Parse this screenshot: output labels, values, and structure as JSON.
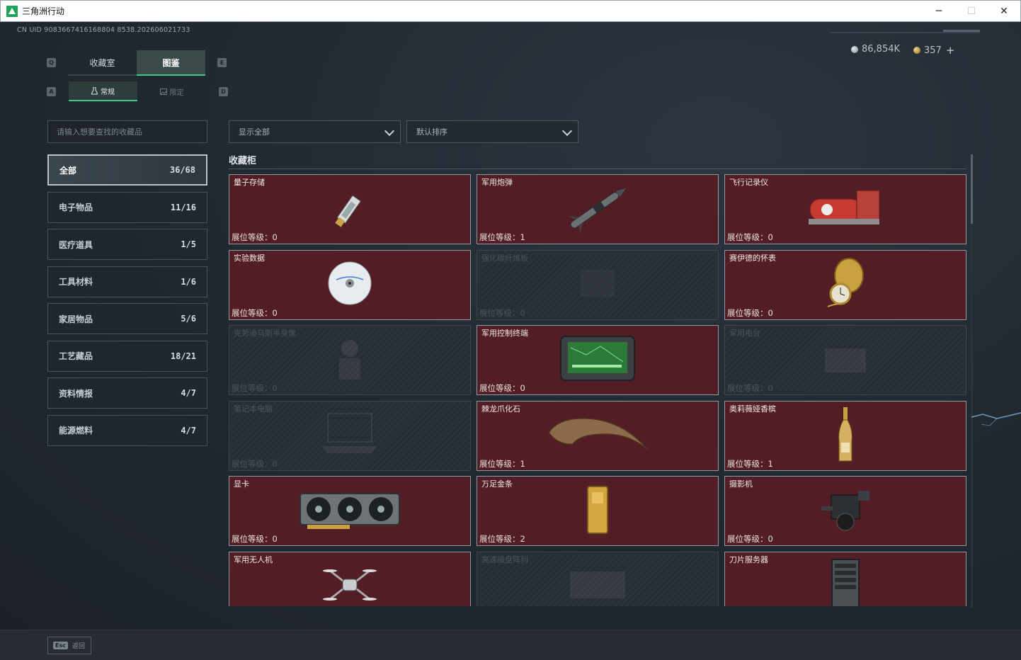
{
  "window": {
    "title": "三角洲行动",
    "minimize": "─",
    "maximize": "☐",
    "close": "✕"
  },
  "uid": "CN UID 9083667416168804 8538.202606021733",
  "currency": {
    "silver": "86,854K",
    "gold": "357",
    "plus": "+"
  },
  "keys": {
    "prev_tab": "Q",
    "next_tab": "E",
    "prev_sub": "A",
    "next_sub": "D"
  },
  "tabs": [
    {
      "label": "收藏室"
    },
    {
      "label": "图鉴"
    }
  ],
  "subtabs": [
    {
      "label": "常规"
    },
    {
      "label": "限定"
    }
  ],
  "search": {
    "placeholder": "请输入想要查找的收藏品"
  },
  "filters": {
    "show": "显示全部",
    "sort": "默认排序"
  },
  "categories": [
    {
      "label": "全部",
      "count": "36/68"
    },
    {
      "label": "电子物品",
      "count": "11/16"
    },
    {
      "label": "医疗道具",
      "count": "1/5"
    },
    {
      "label": "工具材料",
      "count": "1/6"
    },
    {
      "label": "家居物品",
      "count": "5/6"
    },
    {
      "label": "工艺藏品",
      "count": "18/21"
    },
    {
      "label": "资料情报",
      "count": "4/7"
    },
    {
      "label": "能源燃料",
      "count": "4/7"
    }
  ],
  "section_title": "收藏柜",
  "items": [
    {
      "name": "量子存储",
      "level": "展位等级：0",
      "locked": false,
      "icon": "usb-drive-icon"
    },
    {
      "name": "军用炮弹",
      "level": "展位等级：1",
      "locked": false,
      "icon": "missile-icon"
    },
    {
      "name": "飞行记录仪",
      "level": "展位等级：0",
      "locked": false,
      "icon": "flight-recorder-icon"
    },
    {
      "name": "实验数据",
      "level": "展位等级：0",
      "locked": false,
      "icon": "disc-icon"
    },
    {
      "name": "强化碳纤维板",
      "level": "展位等级：0",
      "locked": true,
      "icon": "carbon-plate-icon"
    },
    {
      "name": "赛伊德的怀表",
      "level": "展位等级：0",
      "locked": false,
      "icon": "pocket-watch-icon"
    },
    {
      "name": "克劳迪乌斯半身像",
      "level": "展位等级：0",
      "locked": true,
      "icon": "bust-icon"
    },
    {
      "name": "军用控制终端",
      "level": "展位等级：0",
      "locked": false,
      "icon": "terminal-icon"
    },
    {
      "name": "军用电台",
      "level": "展位等级：0",
      "locked": true,
      "icon": "radio-icon"
    },
    {
      "name": "笔记本电脑",
      "level": "展位等级：0",
      "locked": true,
      "icon": "laptop-icon"
    },
    {
      "name": "棘龙爪化石",
      "level": "展位等级：1",
      "locked": false,
      "icon": "claw-fossil-icon"
    },
    {
      "name": "奥莉薇娅香槟",
      "level": "展位等级：1",
      "locked": false,
      "icon": "champagne-icon"
    },
    {
      "name": "显卡",
      "level": "展位等级：0",
      "locked": false,
      "icon": "gpu-icon"
    },
    {
      "name": "万足金条",
      "level": "展位等级：2",
      "locked": false,
      "icon": "gold-bar-icon"
    },
    {
      "name": "摄影机",
      "level": "展位等级：0",
      "locked": false,
      "icon": "camera-icon"
    },
    {
      "name": "军用无人机",
      "level": "",
      "locked": false,
      "icon": "drone-icon"
    },
    {
      "name": "高速磁盘阵列",
      "level": "",
      "locked": true,
      "icon": "disk-array-icon"
    },
    {
      "name": "刀片服务器",
      "level": "",
      "locked": false,
      "icon": "server-icon"
    }
  ],
  "bottom": {
    "esc_key": "Esc",
    "esc_label": "返回"
  },
  "colors": {
    "accent": "#3fc78a",
    "card_bg": "#521d24",
    "locked_bg": "#262d33"
  }
}
